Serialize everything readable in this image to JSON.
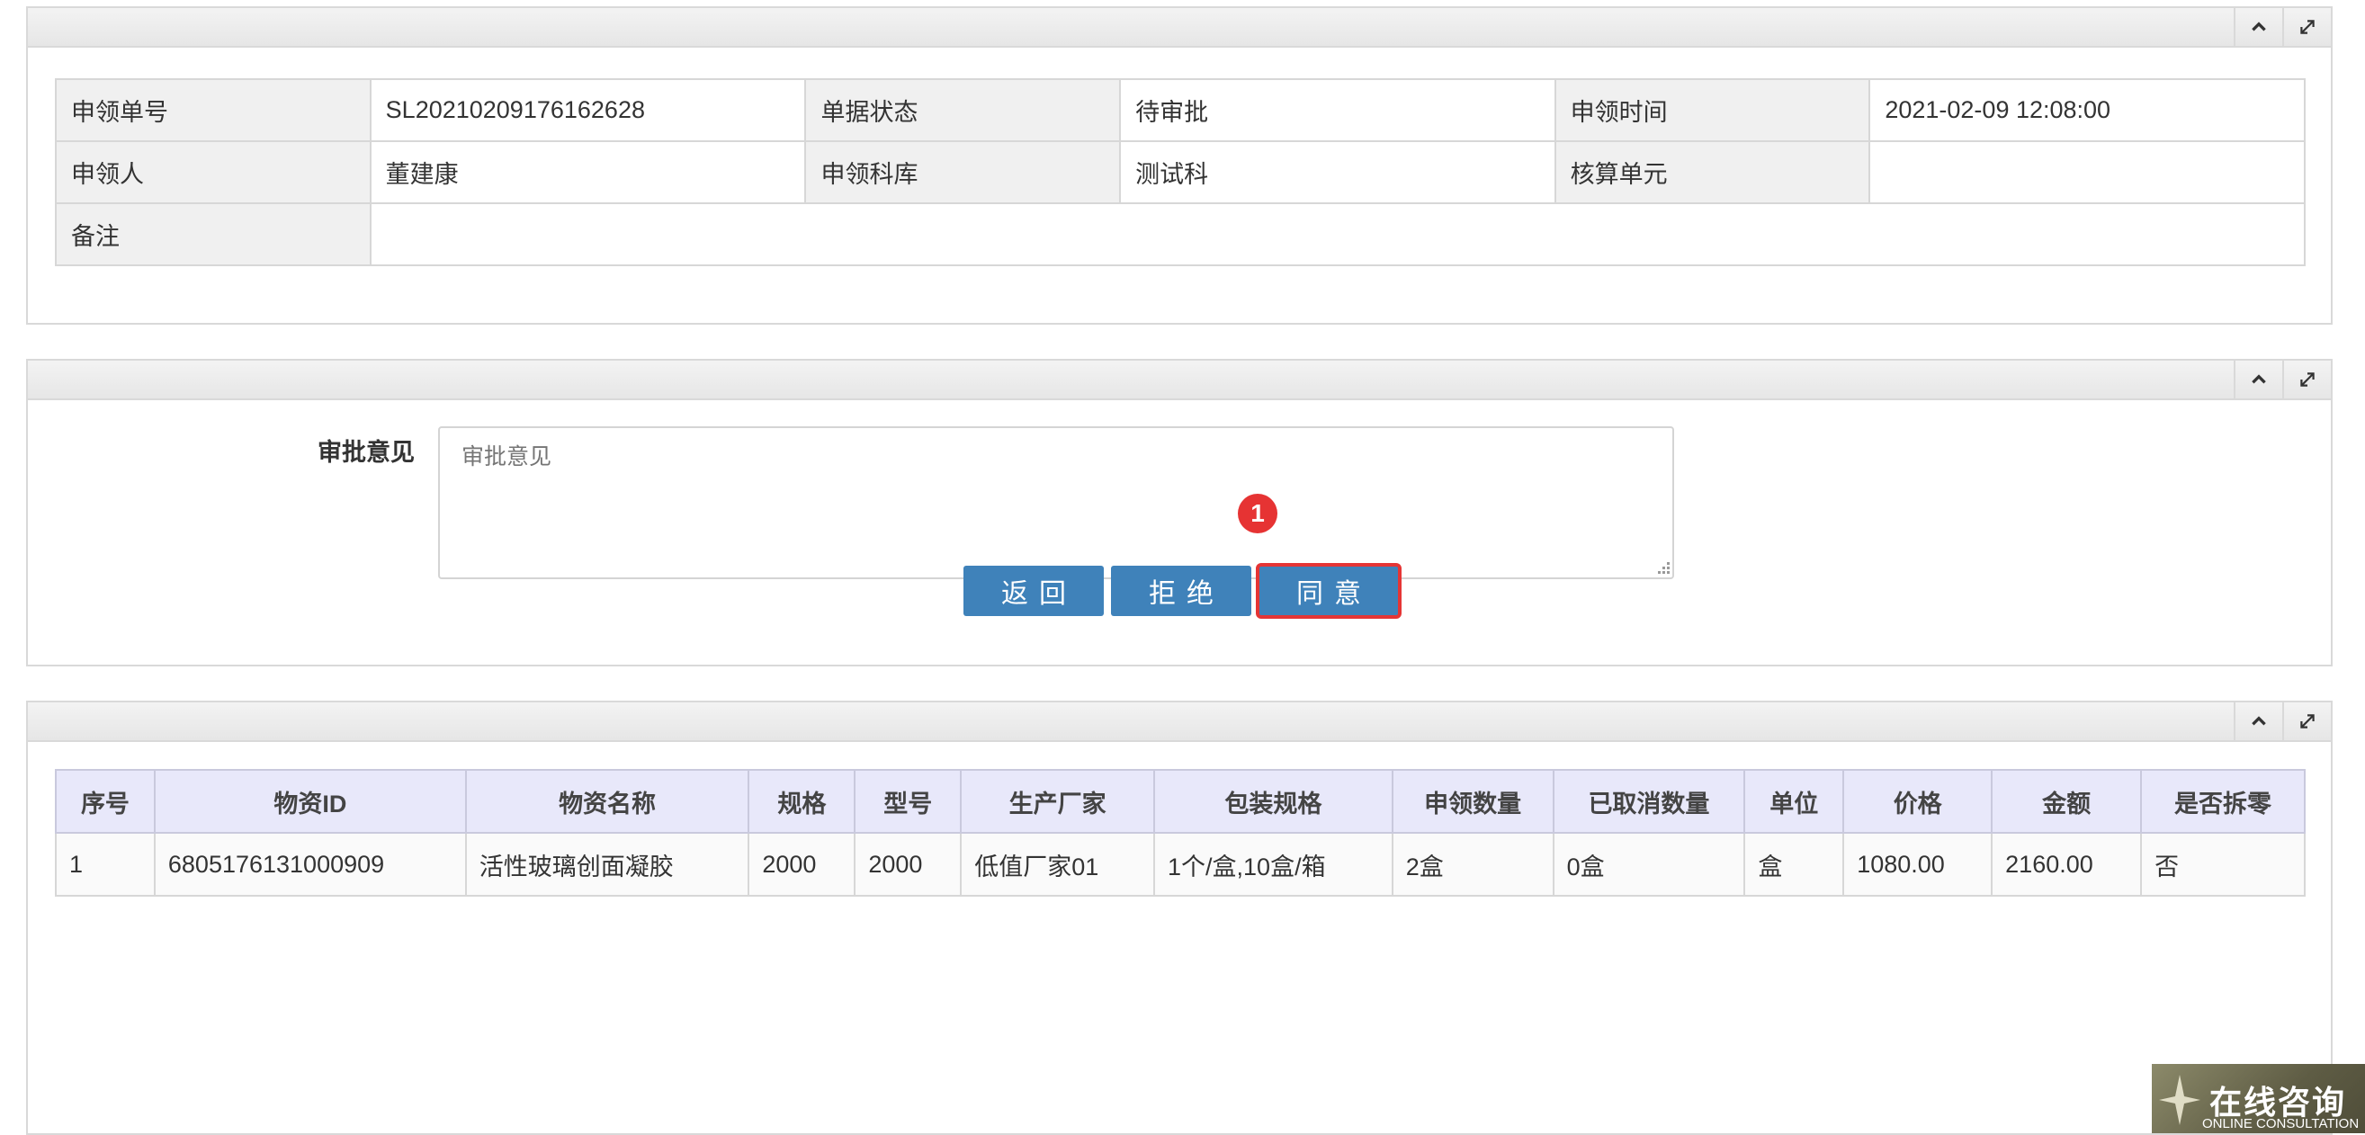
{
  "info_panel": {
    "rows": [
      [
        {
          "label": "申领单号",
          "value": "SL20210209176162628"
        },
        {
          "label": "单据状态",
          "value": "待审批"
        },
        {
          "label": "申领时间",
          "value": "2021-02-09 12:08:00"
        }
      ],
      [
        {
          "label": "申领人",
          "value": "董建康"
        },
        {
          "label": "申领科库",
          "value": "测试科"
        },
        {
          "label": "核算单元",
          "value": ""
        }
      ]
    ],
    "remark_label": "备注",
    "remark_value": ""
  },
  "approval_panel": {
    "opinion_label": "审批意见",
    "opinion_placeholder": "审批意见",
    "buttons": {
      "back": "返回",
      "reject": "拒绝",
      "agree": "同意"
    },
    "marker": "1"
  },
  "items_panel": {
    "columns": [
      "序号",
      "物资ID",
      "物资名称",
      "规格",
      "型号",
      "生产厂家",
      "包装规格",
      "申领数量",
      "已取消数量",
      "单位",
      "价格",
      "金额",
      "是否拆零"
    ],
    "rows": [
      [
        "1",
        "6805176131000909",
        "活性玻璃创面凝胶",
        "2000",
        "2000",
        "低值厂家01",
        "1个/盒,10盒/箱",
        "2盒",
        "0盒",
        "盒",
        "1080.00",
        "2160.00",
        "否"
      ]
    ]
  },
  "consult": {
    "title": "在线咨询",
    "subtitle": "ONLINE CONSULTATION"
  },
  "colors": {
    "button": "#3f82ba",
    "highlight": "#e53535",
    "header_bg": "#e8e8fa"
  }
}
